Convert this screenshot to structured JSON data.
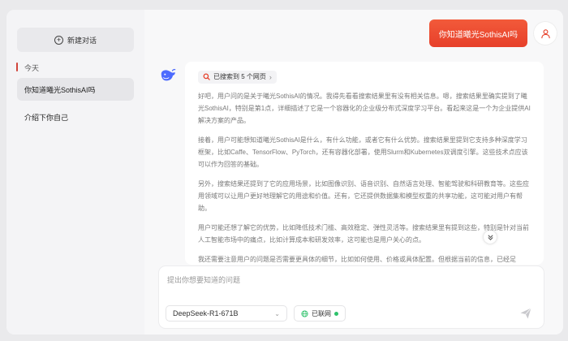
{
  "sidebar": {
    "new_chat_label": "新建对话",
    "section_label": "今天",
    "items": [
      {
        "label": "你知道曦光SothisAI吗",
        "active": true
      },
      {
        "label": "介绍下你自己",
        "active": false
      }
    ]
  },
  "chat": {
    "user_message": "你知道曦光SothisAI吗",
    "search_summary": "已搜索到 5 个网页",
    "paragraphs": [
      "好吧，用户问的是关于曦光SothisAI的情况。我得先看看搜索结果里有没有相关信息。嗯，搜索结果里确实提到了曦光SothisAI，特别是第1点，详细描述了它是一个容器化的企业级分布式深度学习平台。看起来这是一个为企业提供AI解决方案的产品。",
      "接着，用户可能想知道曦光SothisAI是什么，有什么功能，或者它有什么优势。搜索结果里提到它支持多种深度学习框架，比如Caffe、TensorFlow、PyTorch，还有容器化部署，使用Slurm和Kubernetes双调度引擎。这些技术点应该可以作为回答的基础。",
      "另外，搜索结果还提到了它的应用场景，比如图像识别、语音识别、自然语言处理、智能驾驶和科研教育等。这些应用领域可以让用户更好地理解它的用途和价值。还有，它还提供数据集和模型权重的共享功能，这可能对用户有帮助。",
      "用户可能还想了解它的优势，比如降低技术门槛、高效稳定、弹性灵活等。搜索结果里有提到这些，特别是针对当前人工智能市场中的痛点，比如计算成本和研发效率，这可能也是用户关心的点。",
      "我还需要注意用户的问题是否需要更具体的细节，比如如何使用、价格或具体配置。但根据当前的信息，已经足"
    ]
  },
  "composer": {
    "placeholder": "提出你想要知道的问题",
    "model_label": "DeepSeek-R1-671B",
    "online_label": "已联网"
  },
  "colors": {
    "accent": "#e7402a",
    "online": "#2ec26b",
    "sidebar_bg": "#f4f4f6"
  }
}
